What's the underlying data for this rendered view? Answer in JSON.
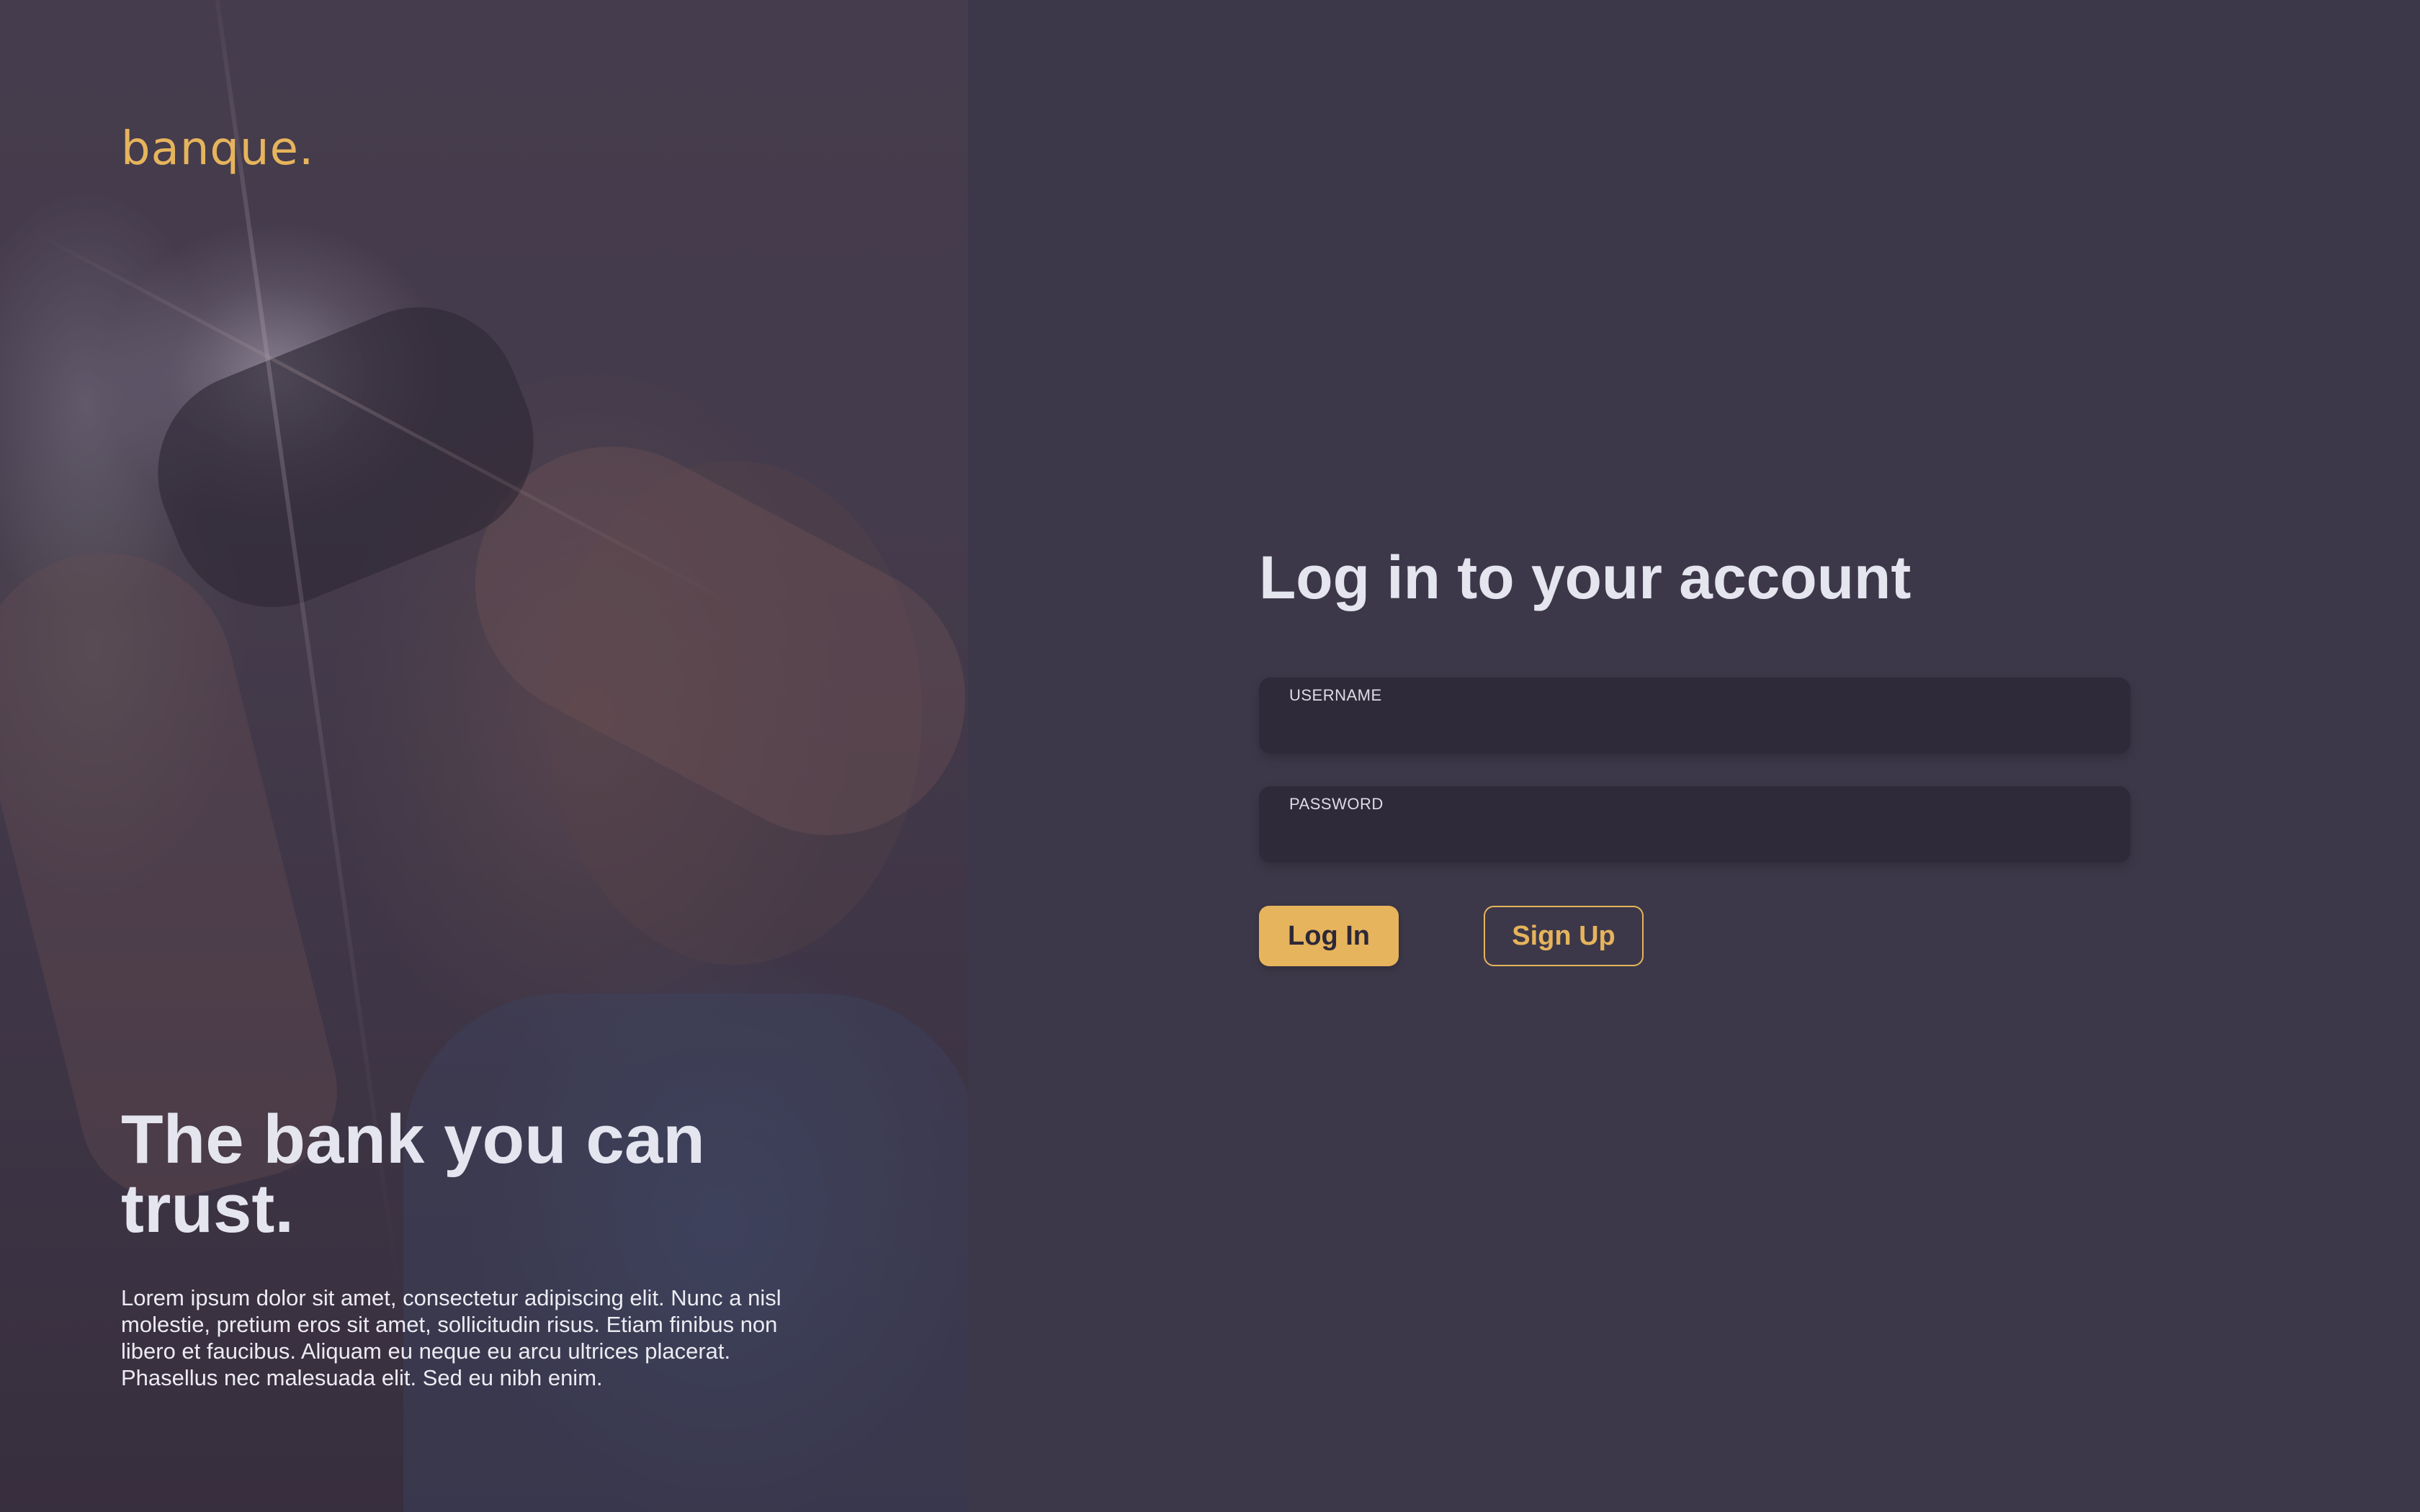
{
  "brand": {
    "logo_text": "banque."
  },
  "hero": {
    "title": "The bank you can trust.",
    "description": "Lorem ipsum dolor sit amet, consectetur adipiscing elit. Nunc a nisl molestie, pretium eros sit amet, sollicitudin risus. Etiam finibus non libero et faucibus. Aliquam eu neque eu arcu ultrices placerat. Phasellus nec malesuada elit. Sed eu nibh enim."
  },
  "login": {
    "title": "Log in to your account",
    "username": {
      "label": "USERNAME",
      "value": ""
    },
    "password": {
      "label": "PASSWORD",
      "value": ""
    },
    "login_button": "Log In",
    "signup_button": "Sign Up"
  },
  "colors": {
    "accent": "#e6b45c",
    "panel_background": "#3d3849",
    "field_background": "#2f2a39",
    "heading_text": "#e4e5ef"
  }
}
